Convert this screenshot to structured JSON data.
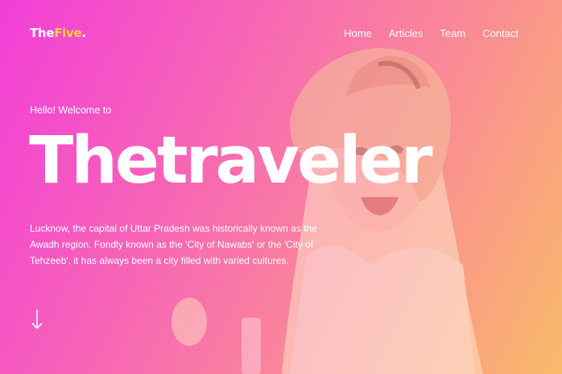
{
  "brand": {
    "part1": "The",
    "part2": "Five",
    "dot": "."
  },
  "nav": {
    "items": [
      {
        "label": "Home"
      },
      {
        "label": "Articles"
      },
      {
        "label": "Team"
      },
      {
        "label": "Contact"
      }
    ]
  },
  "hero": {
    "greeting": "Hello! Welcome to",
    "title": "Thetraveler",
    "description": "Lucknow, the capital of Uttar Pradesh was historically known as the Awadh region. Fondly known as the 'City of Nawabs' or the 'City of Tehzeeb', it has always been a city filled with varied cultures.",
    "scroll_icon": "arrow-down-icon"
  },
  "colors": {
    "gradient_start": "#f23ed8",
    "gradient_end": "#f9ba6a",
    "brand_accent": "#ffd23f",
    "text": "#ffffff"
  }
}
